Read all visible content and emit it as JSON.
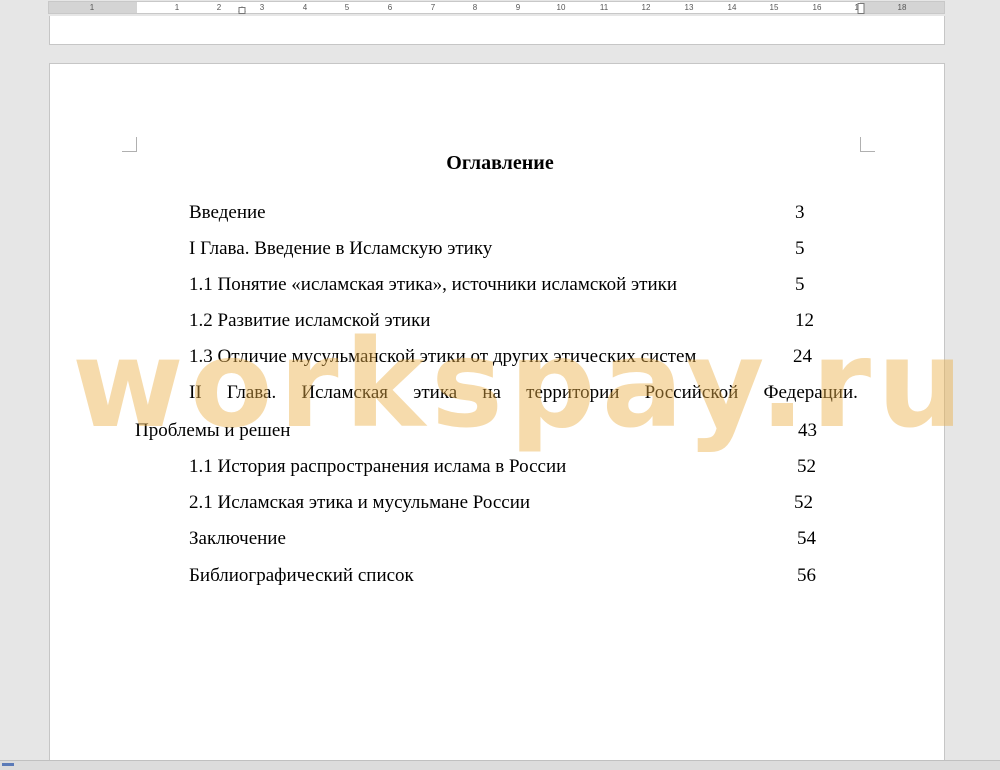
{
  "ruler": {
    "numbers": [
      "1",
      "1",
      "2",
      "3",
      "4",
      "5",
      "6",
      "7",
      "8",
      "9",
      "10",
      "11",
      "12",
      "13",
      "14",
      "15",
      "16",
      "17",
      "18"
    ]
  },
  "document": {
    "title": "Оглавление",
    "entries": [
      {
        "text": "Введение",
        "page": "3"
      },
      {
        "text": "I Глава. Введение в Исламскую этику",
        "page": "5"
      },
      {
        "text": "1.1 Понятие «исламская этика», источники исламской этики",
        "page": "5"
      },
      {
        "text": "1.2 Развитие исламской этики",
        "page": "12"
      },
      {
        "text": "1.3 Отличие мусульманской этики от других этических систем",
        "page": "24"
      },
      {
        "text": "1.1 История распространения ислама в России",
        "page": "52"
      },
      {
        "text": "2.1 Исламская этика и мусульмане России",
        "page": "52"
      },
      {
        "text": "Заключение",
        "page": "54"
      },
      {
        "text": "Библиографический список",
        "page": "56"
      }
    ],
    "chapter2": {
      "words": [
        "II",
        "Глава.",
        "Исламская",
        "этика",
        "на",
        "территории",
        "Российской",
        "Федерации."
      ],
      "continuation": "Проблемы и решен",
      "page": "43"
    }
  },
  "watermark": {
    "text": "workspay.ru",
    "color": "#ebaf46"
  }
}
